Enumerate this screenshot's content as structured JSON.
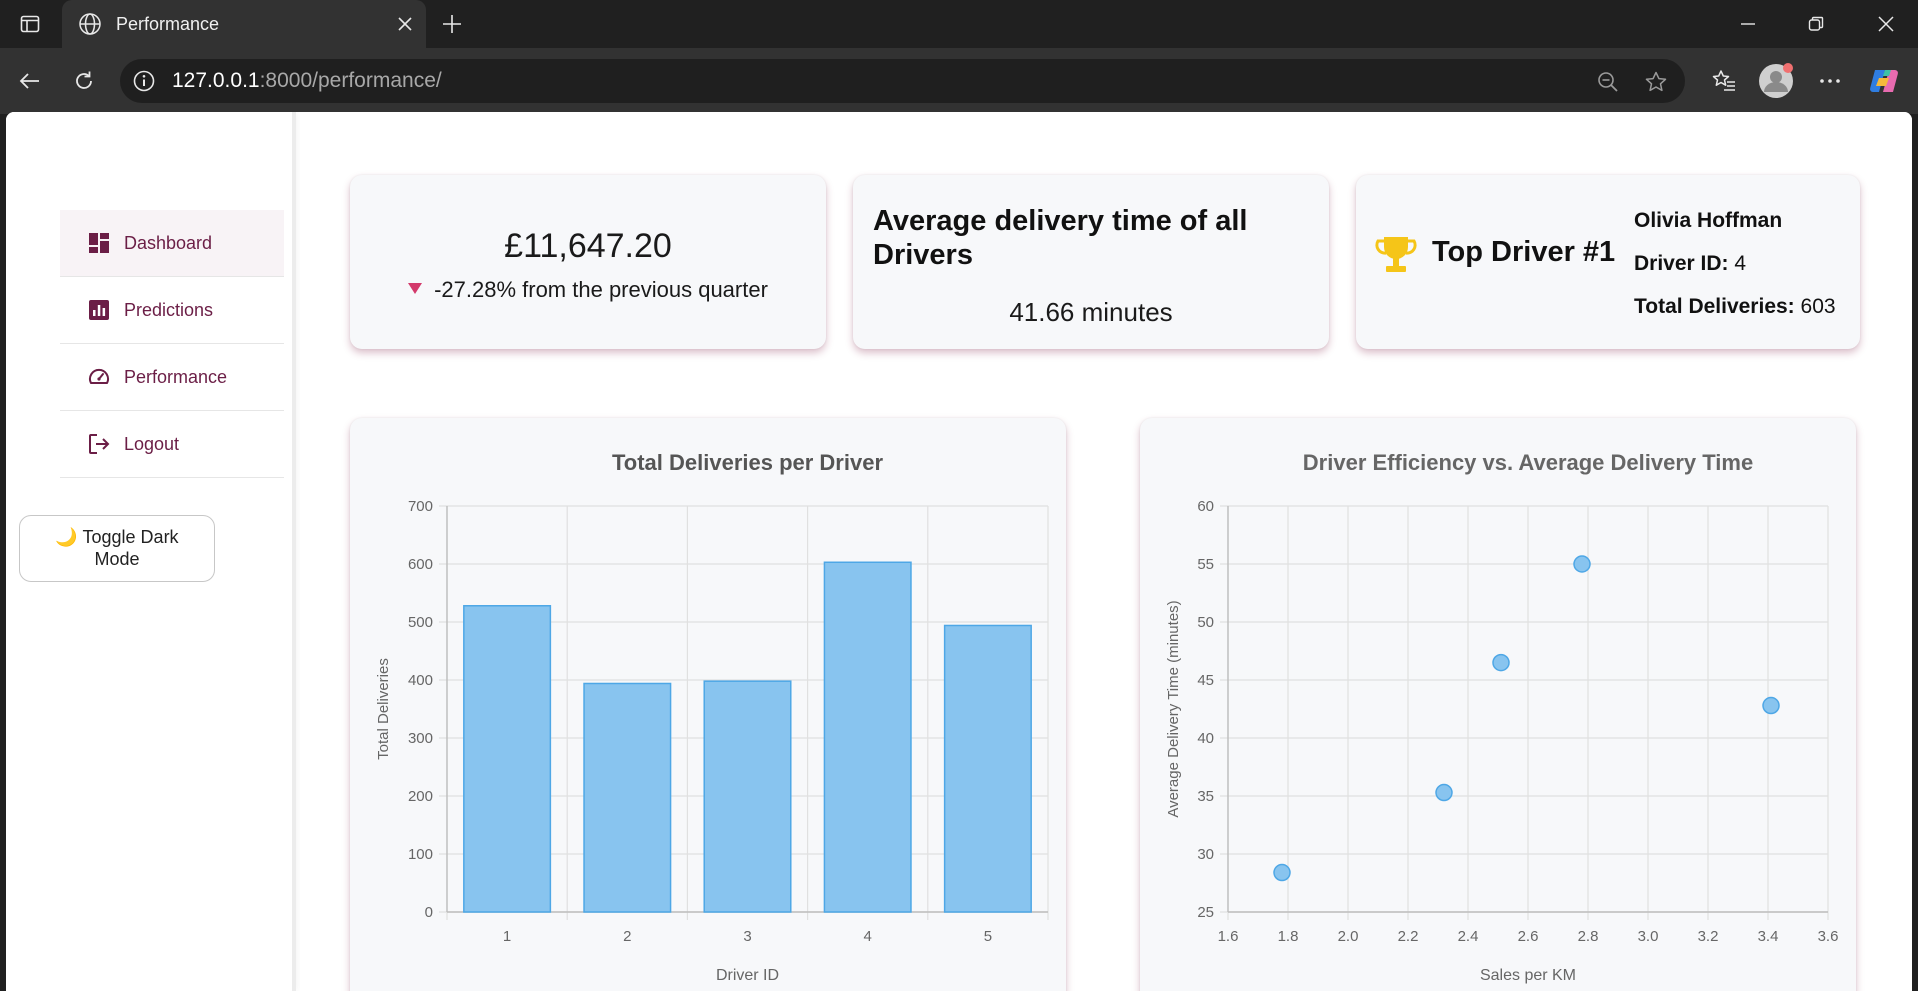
{
  "browser": {
    "tab_title": "Performance",
    "url_host": "127.0.0.1",
    "url_path": ":8000/performance/"
  },
  "sidebar": {
    "items": [
      {
        "label": "Dashboard",
        "icon": "dashboard-icon",
        "active": true
      },
      {
        "label": "Predictions",
        "icon": "bar-chart-icon",
        "active": false
      },
      {
        "label": "Performance",
        "icon": "gauge-icon",
        "active": false
      },
      {
        "label": "Logout",
        "icon": "logout-icon",
        "active": false
      }
    ],
    "toggle_label": "🌙 Toggle Dark Mode"
  },
  "kpis": {
    "revenue": "£11,647.20",
    "revenue_change": "-27.28% from the previous quarter",
    "avg_time_title": "Average delivery time of all Drivers",
    "avg_time_value": "41.66 minutes",
    "top_driver_title": "Top Driver #1",
    "top_driver_name": "Olivia Hoffman",
    "driver_id_label": "Driver ID:",
    "driver_id_value": "4",
    "total_deliveries_label": "Total Deliveries:",
    "total_deliveries_value": "603"
  },
  "colors": {
    "accent": "#6b1e46",
    "bar_fill": "#88c4ef",
    "bar_stroke": "#4ea7e6",
    "down": "#d33a6b",
    "trophy": "#f5c518"
  },
  "chart_data": [
    {
      "type": "bar",
      "title": "Total Deliveries per Driver",
      "xlabel": "Driver ID",
      "ylabel": "Total Deliveries",
      "categories": [
        "1",
        "2",
        "3",
        "4",
        "5"
      ],
      "values": [
        528,
        394,
        398,
        603,
        494
      ],
      "ylim": [
        0,
        700
      ],
      "yticks": [
        0,
        100,
        200,
        300,
        400,
        500,
        600,
        700
      ],
      "grid": true
    },
    {
      "type": "scatter",
      "title": "Driver Efficiency vs. Average Delivery Time",
      "xlabel": "Sales per KM",
      "ylabel": "Average Delivery Time (minutes)",
      "points": [
        {
          "x": 1.78,
          "y": 28.4
        },
        {
          "x": 2.32,
          "y": 35.3
        },
        {
          "x": 2.51,
          "y": 46.5
        },
        {
          "x": 2.78,
          "y": 55.0
        },
        {
          "x": 3.41,
          "y": 42.8
        }
      ],
      "xlim": [
        1.6,
        3.6
      ],
      "ylim": [
        25,
        60
      ],
      "xticks": [
        "1.6",
        "1.8",
        "2.0",
        "2.2",
        "2.4",
        "2.6",
        "2.8",
        "3.0",
        "3.2",
        "3.4",
        "3.6"
      ],
      "yticks": [
        25,
        30,
        35,
        40,
        45,
        50,
        55,
        60
      ],
      "grid": true
    }
  ]
}
